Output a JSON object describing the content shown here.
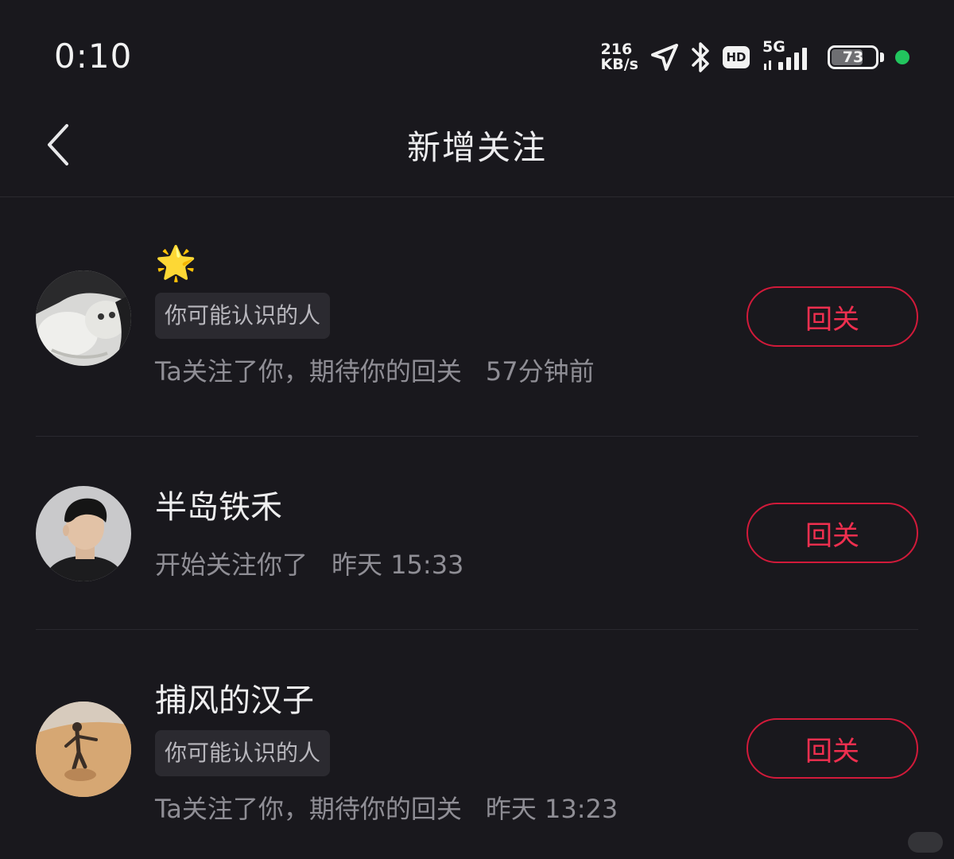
{
  "status_bar": {
    "time": "0:10",
    "net_speed_value": "216",
    "net_speed_unit": "KB/s",
    "hd_label": "HD",
    "network_type": "5G",
    "battery_level": "73",
    "battery_fraction": 0.73,
    "dot_color": "#22c55e"
  },
  "header": {
    "title": "新增关注"
  },
  "items": [
    {
      "name": "🌟",
      "tag": "你可能认识的人",
      "message": "Ta关注了你，期待你的回关",
      "time": "57分钟前",
      "button": "回关",
      "avatar": "cat-avatar"
    },
    {
      "name": "半岛铁禾",
      "message": "开始关注你了",
      "time": "昨天 15:33",
      "button": "回关",
      "avatar": "man-portrait-avatar"
    },
    {
      "name": "捕风的汉子",
      "tag": "你可能认识的人",
      "message": "Ta关注了你，期待你的回关",
      "time": "昨天 13:23",
      "button": "回关",
      "avatar": "desert-person-avatar"
    }
  ],
  "colors": {
    "background": "#19181d",
    "accent": "#ef2f4f",
    "button_border": "#d11a3a"
  }
}
